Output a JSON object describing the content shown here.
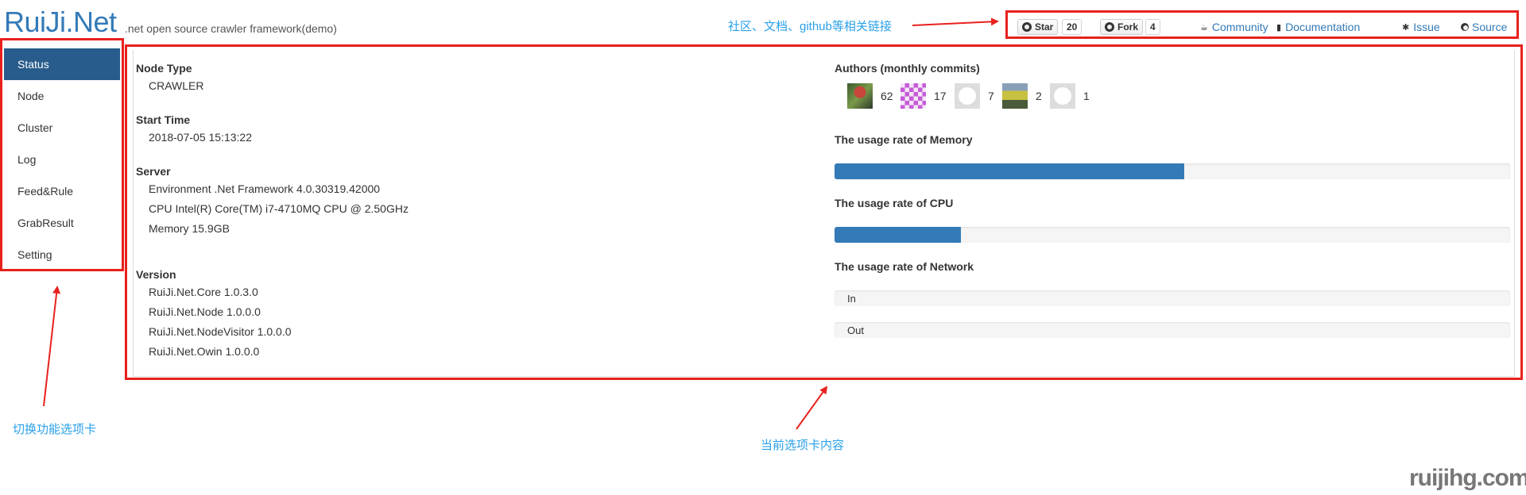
{
  "brand": {
    "name": "RuiJi.Net",
    "tagline": ".net open source crawler framework(demo)"
  },
  "top_links": {
    "star_label": "Star",
    "star_count": "20",
    "fork_label": "Fork",
    "fork_count": "4",
    "community": "Community",
    "documentation": "Documentation",
    "issue": "Issue",
    "source": "Source"
  },
  "annotations": {
    "links": "社区、文档、github等相关链接",
    "tabs": "切换功能选项卡",
    "content": "当前选项卡内容"
  },
  "sidebar": {
    "items": [
      {
        "label": "Status",
        "active": true
      },
      {
        "label": "Node"
      },
      {
        "label": "Cluster"
      },
      {
        "label": "Log"
      },
      {
        "label": "Feed&Rule"
      },
      {
        "label": "GrabResult"
      },
      {
        "label": "Setting"
      }
    ]
  },
  "status": {
    "node_type_label": "Node Type",
    "node_type": "CRAWLER",
    "start_time_label": "Start Time",
    "start_time": "2018-07-05 15:13:22",
    "server_label": "Server",
    "server_environment": "Environment .Net Framework 4.0.30319.42000",
    "server_cpu": "CPU Intel(R) Core(TM) i7-4710MQ CPU @ 2.50GHz",
    "server_memory": "Memory 15.9GB",
    "version_label": "Version",
    "versions": [
      "RuiJi.Net.Core 1.0.3.0",
      "RuiJi.Net.Node 1.0.0.0",
      "RuiJi.Net.NodeVisitor 1.0.0.0",
      "RuiJi.Net.Owin 1.0.0.0"
    ],
    "authors_label": "Authors (monthly commits)",
    "authors": [
      {
        "commits": "62",
        "avatar": "photo-avatar"
      },
      {
        "commits": "17",
        "avatar": "identicon-avatar"
      },
      {
        "commits": "7",
        "avatar": "github-default-avatar"
      },
      {
        "commits": "2",
        "avatar": "photo-avatar"
      },
      {
        "commits": "1",
        "avatar": "github-default-avatar"
      }
    ],
    "memory_label": "The usage rate of Memory",
    "memory_rate": 0.518,
    "cpu_label": "The usage rate of CPU",
    "cpu_rate": 0.187,
    "network_label": "The usage rate of Network",
    "network_in": "In",
    "network_out": "Out"
  },
  "watermark": "ruijihg.com",
  "colors": {
    "accent": "#337ab7",
    "sidebar_active": "#285c8c",
    "annotation_box": "#e8211d",
    "annotation_text": "#2aa0e8"
  }
}
